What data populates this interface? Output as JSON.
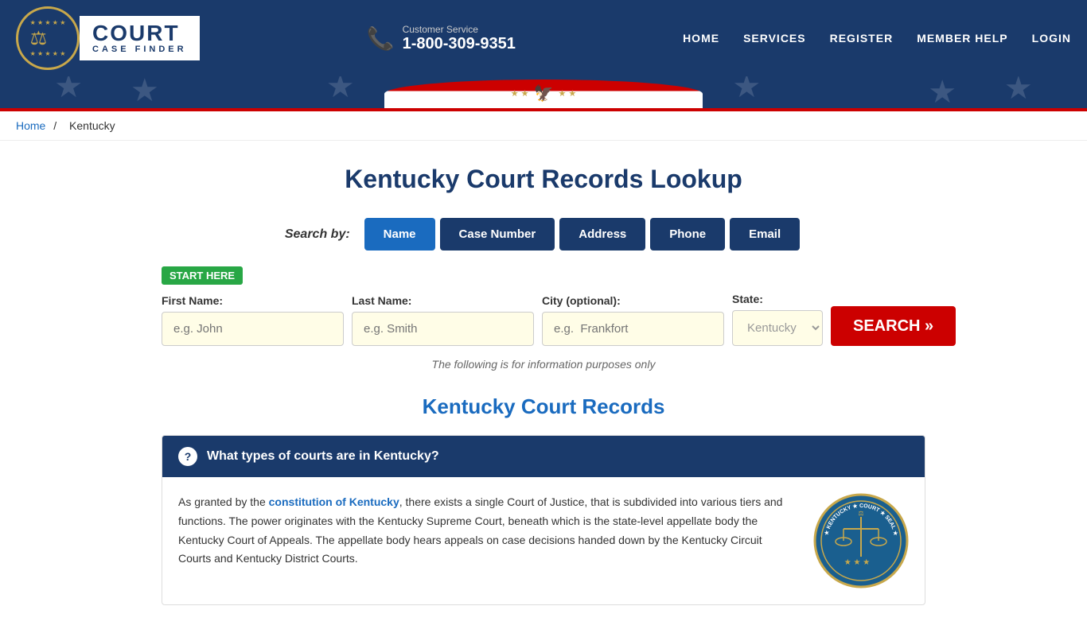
{
  "header": {
    "logo": {
      "court_text": "COURT",
      "case_finder_text": "CASE FINDER",
      "scales_icon": "⚖"
    },
    "customer_service": {
      "label": "Customer Service",
      "phone": "1-800-309-9351",
      "phone_icon": "📞"
    },
    "nav": {
      "items": [
        {
          "label": "HOME",
          "href": "#"
        },
        {
          "label": "SERVICES",
          "href": "#"
        },
        {
          "label": "REGISTER",
          "href": "#"
        },
        {
          "label": "MEMBER HELP",
          "href": "#"
        },
        {
          "label": "LOGIN",
          "href": "#"
        }
      ]
    }
  },
  "breadcrumb": {
    "home_label": "Home",
    "separator": "/",
    "current": "Kentucky"
  },
  "page": {
    "title": "Kentucky Court Records Lookup",
    "search_by_label": "Search by:",
    "search_tabs": [
      {
        "label": "Name",
        "active": true
      },
      {
        "label": "Case Number",
        "active": false
      },
      {
        "label": "Address",
        "active": false
      },
      {
        "label": "Phone",
        "active": false
      },
      {
        "label": "Email",
        "active": false
      }
    ],
    "start_here_badge": "START HERE",
    "form": {
      "first_name_label": "First Name:",
      "first_name_placeholder": "e.g. John",
      "last_name_label": "Last Name:",
      "last_name_placeholder": "e.g. Smith",
      "city_label": "City (optional):",
      "city_placeholder": "e.g.  Frankfort",
      "state_label": "State:",
      "state_default": "Kentucky",
      "search_button": "SEARCH »"
    },
    "info_note": "The following is for information purposes only",
    "section_title": "Kentucky Court Records",
    "faq": {
      "question": "What types of courts are in Kentucky?",
      "icon": "?",
      "body": "As granted by the constitution of Kentucky, there exists a single Court of Justice, that is subdivided into various tiers and functions. The power originates with the Kentucky Supreme Court, beneath which is the state-level appellate body the Kentucky Court of Appeals. The appellate body hears appeals on case decisions handed down by the Kentucky Circuit Courts and Kentucky District Courts.",
      "constitution_link": "constitution of Kentucky"
    }
  }
}
